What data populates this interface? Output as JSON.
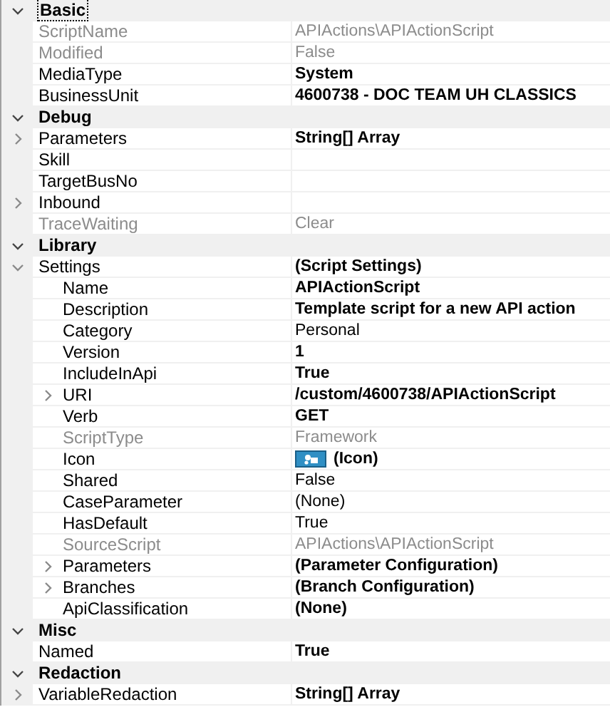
{
  "categories": [
    {
      "label": "Basic",
      "expanded": true,
      "focused": true,
      "properties": [
        {
          "name": "ScriptName",
          "value": "APIActions\\APIActionScript",
          "disabled": true,
          "modified": false,
          "kind": "plain"
        },
        {
          "name": "Modified",
          "value": "False",
          "disabled": true,
          "modified": false,
          "kind": "plain"
        },
        {
          "name": "MediaType",
          "value": "System",
          "disabled": false,
          "modified": true,
          "kind": "plain"
        },
        {
          "name": "BusinessUnit",
          "value": "4600738 - DOC TEAM UH CLASSICS",
          "disabled": false,
          "modified": true,
          "kind": "plain"
        }
      ]
    },
    {
      "label": "Debug",
      "expanded": true,
      "focused": false,
      "properties": [
        {
          "name": "Parameters",
          "value": "String[] Array",
          "disabled": false,
          "modified": true,
          "kind": "expandable",
          "expanded": false
        },
        {
          "name": "Skill",
          "disabled": false,
          "kind": "plain"
        },
        {
          "name": "TargetBusNo",
          "disabled": false,
          "kind": "plain"
        },
        {
          "name": "Inbound",
          "disabled": false,
          "kind": "expandable",
          "expanded": false
        },
        {
          "name": "TraceWaiting",
          "value": "Clear",
          "disabled": true,
          "modified": false,
          "kind": "plain"
        }
      ]
    },
    {
      "label": "Library",
      "expanded": true,
      "focused": false,
      "properties": [
        {
          "name": "Settings",
          "value": "(Script Settings)",
          "disabled": false,
          "modified": true,
          "kind": "expandable",
          "expanded": true,
          "children": [
            {
              "name": "Name",
              "value": "APIActionScript",
              "disabled": false,
              "modified": true,
              "kind": "plain"
            },
            {
              "name": "Description",
              "value": "Template script for a new API action",
              "disabled": false,
              "modified": true,
              "kind": "plain"
            },
            {
              "name": "Category",
              "value": "Personal",
              "disabled": false,
              "modified": false,
              "kind": "plain"
            },
            {
              "name": "Version",
              "value": "1",
              "disabled": false,
              "modified": true,
              "kind": "plain"
            },
            {
              "name": "IncludeInApi",
              "value": "True",
              "disabled": false,
              "modified": true,
              "kind": "plain"
            },
            {
              "name": "URI",
              "value": "/custom/4600738/APIActionScript",
              "disabled": false,
              "modified": true,
              "kind": "expandable",
              "expanded": false
            },
            {
              "name": "Verb",
              "value": "GET",
              "disabled": false,
              "modified": true,
              "kind": "plain"
            },
            {
              "name": "ScriptType",
              "value": "Framework",
              "disabled": true,
              "modified": false,
              "kind": "plain"
            },
            {
              "name": "Icon",
              "value": "(Icon)",
              "disabled": false,
              "modified": true,
              "kind": "icon"
            },
            {
              "name": "Shared",
              "value": "False",
              "disabled": false,
              "modified": false,
              "kind": "plain"
            },
            {
              "name": "CaseParameter",
              "value": "(None)",
              "disabled": false,
              "modified": false,
              "kind": "plain"
            },
            {
              "name": "HasDefault",
              "value": "True",
              "disabled": false,
              "modified": false,
              "kind": "plain"
            },
            {
              "name": "SourceScript",
              "value": "APIActions\\APIActionScript",
              "disabled": true,
              "modified": false,
              "kind": "plain"
            },
            {
              "name": "Parameters",
              "value": "(Parameter Configuration)",
              "disabled": false,
              "modified": true,
              "kind": "expandable",
              "expanded": false
            },
            {
              "name": "Branches",
              "value": "(Branch Configuration)",
              "disabled": false,
              "modified": true,
              "kind": "expandable",
              "expanded": false
            },
            {
              "name": "ApiClassification",
              "value": "(None)",
              "disabled": false,
              "modified": true,
              "kind": "plain"
            }
          ]
        }
      ]
    },
    {
      "label": "Misc",
      "expanded": true,
      "focused": false,
      "properties": [
        {
          "name": "Named",
          "value": "True",
          "disabled": false,
          "modified": true,
          "kind": "plain"
        }
      ]
    },
    {
      "label": "Redaction",
      "expanded": true,
      "focused": false,
      "properties": [
        {
          "name": "VariableRedaction",
          "value": "String[] Array",
          "disabled": false,
          "modified": true,
          "kind": "expandable",
          "expanded": false
        }
      ]
    }
  ]
}
